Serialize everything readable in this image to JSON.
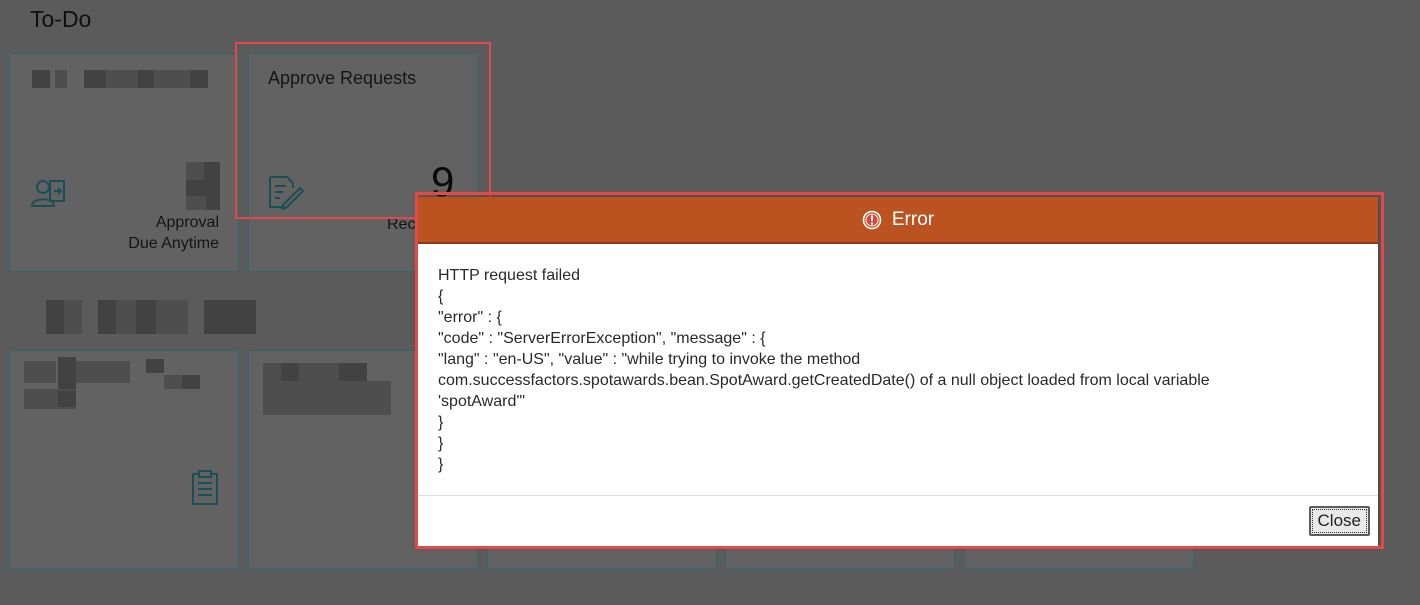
{
  "section": {
    "title": "To-Do"
  },
  "tiles": {
    "approval": {
      "footer_line1": "Approval",
      "footer_line2": "Due Anytime"
    },
    "approve_requests": {
      "title": "Approve Requests",
      "count": "9",
      "footer_partial": "Rec"
    }
  },
  "dialog": {
    "title": "Error",
    "body_lines": [
      "HTTP request failed",
      "{",
      "\"error\" : {",
      "\"code\" : \"ServerErrorException\", \"message\" : {",
      "\"lang\" : \"en-US\", \"value\" : \"while trying to invoke the method",
      "com.successfactors.spotawards.bean.SpotAward.getCreatedDate() of a null object loaded from local variable",
      "'spotAward'\"",
      "}",
      "}",
      "}"
    ],
    "close_label": "Close"
  },
  "colors": {
    "overlay": "#5b5b5b",
    "dialog_header": "#ba5320",
    "highlight": "#e54848",
    "tile_border": "#2f6a6a"
  },
  "icons": {
    "approval_tile": "user-transfer-icon",
    "approve_requests_tile": "document-edit-icon",
    "task_tile": "clipboard-list-icon",
    "dialog_header": "error-circle-icon"
  }
}
